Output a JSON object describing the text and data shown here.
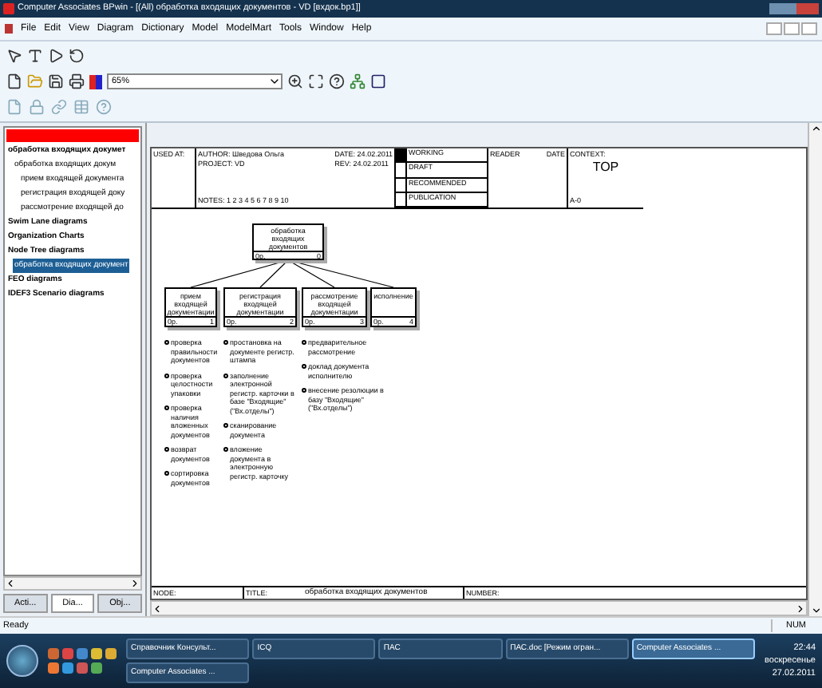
{
  "window": {
    "title": "Computer Associates BPwin - [(All) обработка входящих документов - VD  [вхдок.bp1]]",
    "menu": [
      "File",
      "Edit",
      "View",
      "Diagram",
      "Dictionary",
      "Model",
      "ModelMart",
      "Tools",
      "Window",
      "Help"
    ]
  },
  "toolbar": {
    "zoom": "65%"
  },
  "explorer": {
    "tree": [
      {
        "label": "обработка входящих докумет",
        "selected": false,
        "children": [
          {
            "label": "обработка входящих докум",
            "selected": false,
            "children": [
              {
                "label": "прием входящей документа",
                "selected": false
              },
              {
                "label": "регистрация входящей доку",
                "selected": false
              },
              {
                "label": "рассмотрение входящей до",
                "selected": false
              }
            ]
          }
        ]
      },
      {
        "label": "Swim Lane diagrams",
        "selected": false
      },
      {
        "label": "Organization Charts",
        "selected": false
      },
      {
        "label": "Node Tree diagrams",
        "selected": false,
        "children": [
          {
            "label": "обработка входящих документ",
            "selected": true
          }
        ]
      },
      {
        "label": "FEO diagrams",
        "selected": false
      },
      {
        "label": "IDEF3 Scenario diagrams",
        "selected": false
      }
    ],
    "tabs": [
      {
        "label": "Acti...",
        "selected": false
      },
      {
        "label": "Dia...",
        "selected": true
      },
      {
        "label": "Obj...",
        "selected": false
      }
    ]
  },
  "diagram": {
    "header": {
      "used_at": "USED AT:",
      "author": "AUTHOR:  Шведова Ольга",
      "project": "PROJECT:  VD",
      "notes": "NOTES:  1  2  3  4  5  6  7  8  9  10",
      "date": "DATE:  24.02.2011",
      "rev": "REV:  24.02.2011",
      "status": [
        {
          "label": "WORKING",
          "checked": true
        },
        {
          "label": "DRAFT",
          "checked": false
        },
        {
          "label": "RECOMMENDED",
          "checked": false
        },
        {
          "label": "PUBLICATION",
          "checked": false
        }
      ],
      "reader": "READER",
      "reader_date": "DATE",
      "context": "CONTEXT:",
      "context_value": "TOP",
      "node": "A-0"
    },
    "root": {
      "label": "обработка входящих документов",
      "cost": "0р.",
      "number": "0"
    },
    "nodes": [
      {
        "label": "прием входящей документации",
        "cost": "0р.",
        "number": "1",
        "notes": [
          "проверка правильности документов",
          "проверка целостности упаковки",
          "проверка наличия вложенных документов",
          "возврат документов",
          "сортировка документов"
        ]
      },
      {
        "label": "регистрация входящей документации",
        "cost": "0р.",
        "number": "2",
        "notes": [
          "простановка на документе регистр. штампа",
          "заполнение электронной регистр. карточки в базе \"Входящие\" (\"Вх.отделы\")",
          "сканирование документа",
          "вложение документа в электронную регистр. карточку"
        ]
      },
      {
        "label": "рассмотрение входящей документации",
        "cost": "0р.",
        "number": "3",
        "notes": [
          "предварительное рассмотрение",
          "доклад документа исполнителю",
          "внесение резолюции в базу \"Входящие\" (\"Вх.отделы\")"
        ]
      },
      {
        "label": "исполнение",
        "cost": "0р.",
        "number": "4"
      }
    ],
    "footer": [
      "NODE:",
      "TITLE:",
      "обработка входящих документов",
      "NUMBER:"
    ]
  },
  "status_bar": {
    "message": "Ready",
    "indicator": "NUM"
  },
  "taskbar": {
    "tasks": [
      {
        "label": "Справочник Консульт...",
        "selected": false
      },
      {
        "label": "ICQ",
        "selected": false
      },
      {
        "label": "ПАС",
        "selected": false
      },
      {
        "label": "ПАС.doc [Режим огран...",
        "selected": false
      },
      {
        "label": "Computer Associates ...",
        "selected": true
      },
      {
        "label": "Computer Associates ...",
        "selected": false
      }
    ],
    "clock": {
      "time": "22:44",
      "day": "воскресенье",
      "date": "27.02.2011"
    }
  }
}
